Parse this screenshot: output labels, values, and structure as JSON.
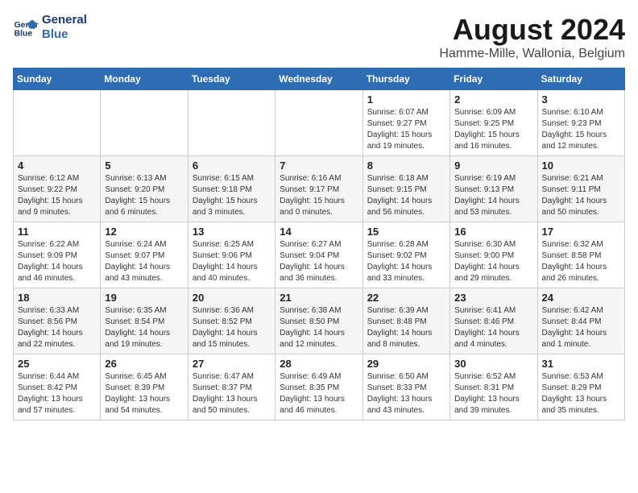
{
  "header": {
    "logo_line1": "General",
    "logo_line2": "Blue",
    "month": "August 2024",
    "location": "Hamme-Mille, Wallonia, Belgium"
  },
  "weekdays": [
    "Sunday",
    "Monday",
    "Tuesday",
    "Wednesday",
    "Thursday",
    "Friday",
    "Saturday"
  ],
  "weeks": [
    [
      {
        "day": "",
        "content": ""
      },
      {
        "day": "",
        "content": ""
      },
      {
        "day": "",
        "content": ""
      },
      {
        "day": "",
        "content": ""
      },
      {
        "day": "1",
        "content": "Sunrise: 6:07 AM\nSunset: 9:27 PM\nDaylight: 15 hours\nand 19 minutes."
      },
      {
        "day": "2",
        "content": "Sunrise: 6:09 AM\nSunset: 9:25 PM\nDaylight: 15 hours\nand 16 minutes."
      },
      {
        "day": "3",
        "content": "Sunrise: 6:10 AM\nSunset: 9:23 PM\nDaylight: 15 hours\nand 12 minutes."
      }
    ],
    [
      {
        "day": "4",
        "content": "Sunrise: 6:12 AM\nSunset: 9:22 PM\nDaylight: 15 hours\nand 9 minutes."
      },
      {
        "day": "5",
        "content": "Sunrise: 6:13 AM\nSunset: 9:20 PM\nDaylight: 15 hours\nand 6 minutes."
      },
      {
        "day": "6",
        "content": "Sunrise: 6:15 AM\nSunset: 9:18 PM\nDaylight: 15 hours\nand 3 minutes."
      },
      {
        "day": "7",
        "content": "Sunrise: 6:16 AM\nSunset: 9:17 PM\nDaylight: 15 hours\nand 0 minutes."
      },
      {
        "day": "8",
        "content": "Sunrise: 6:18 AM\nSunset: 9:15 PM\nDaylight: 14 hours\nand 56 minutes."
      },
      {
        "day": "9",
        "content": "Sunrise: 6:19 AM\nSunset: 9:13 PM\nDaylight: 14 hours\nand 53 minutes."
      },
      {
        "day": "10",
        "content": "Sunrise: 6:21 AM\nSunset: 9:11 PM\nDaylight: 14 hours\nand 50 minutes."
      }
    ],
    [
      {
        "day": "11",
        "content": "Sunrise: 6:22 AM\nSunset: 9:09 PM\nDaylight: 14 hours\nand 46 minutes."
      },
      {
        "day": "12",
        "content": "Sunrise: 6:24 AM\nSunset: 9:07 PM\nDaylight: 14 hours\nand 43 minutes."
      },
      {
        "day": "13",
        "content": "Sunrise: 6:25 AM\nSunset: 9:06 PM\nDaylight: 14 hours\nand 40 minutes."
      },
      {
        "day": "14",
        "content": "Sunrise: 6:27 AM\nSunset: 9:04 PM\nDaylight: 14 hours\nand 36 minutes."
      },
      {
        "day": "15",
        "content": "Sunrise: 6:28 AM\nSunset: 9:02 PM\nDaylight: 14 hours\nand 33 minutes."
      },
      {
        "day": "16",
        "content": "Sunrise: 6:30 AM\nSunset: 9:00 PM\nDaylight: 14 hours\nand 29 minutes."
      },
      {
        "day": "17",
        "content": "Sunrise: 6:32 AM\nSunset: 8:58 PM\nDaylight: 14 hours\nand 26 minutes."
      }
    ],
    [
      {
        "day": "18",
        "content": "Sunrise: 6:33 AM\nSunset: 8:56 PM\nDaylight: 14 hours\nand 22 minutes."
      },
      {
        "day": "19",
        "content": "Sunrise: 6:35 AM\nSunset: 8:54 PM\nDaylight: 14 hours\nand 19 minutes."
      },
      {
        "day": "20",
        "content": "Sunrise: 6:36 AM\nSunset: 8:52 PM\nDaylight: 14 hours\nand 15 minutes."
      },
      {
        "day": "21",
        "content": "Sunrise: 6:38 AM\nSunset: 8:50 PM\nDaylight: 14 hours\nand 12 minutes."
      },
      {
        "day": "22",
        "content": "Sunrise: 6:39 AM\nSunset: 8:48 PM\nDaylight: 14 hours\nand 8 minutes."
      },
      {
        "day": "23",
        "content": "Sunrise: 6:41 AM\nSunset: 8:46 PM\nDaylight: 14 hours\nand 4 minutes."
      },
      {
        "day": "24",
        "content": "Sunrise: 6:42 AM\nSunset: 8:44 PM\nDaylight: 14 hours\nand 1 minute."
      }
    ],
    [
      {
        "day": "25",
        "content": "Sunrise: 6:44 AM\nSunset: 8:42 PM\nDaylight: 13 hours\nand 57 minutes."
      },
      {
        "day": "26",
        "content": "Sunrise: 6:45 AM\nSunset: 8:39 PM\nDaylight: 13 hours\nand 54 minutes."
      },
      {
        "day": "27",
        "content": "Sunrise: 6:47 AM\nSunset: 8:37 PM\nDaylight: 13 hours\nand 50 minutes."
      },
      {
        "day": "28",
        "content": "Sunrise: 6:49 AM\nSunset: 8:35 PM\nDaylight: 13 hours\nand 46 minutes."
      },
      {
        "day": "29",
        "content": "Sunrise: 6:50 AM\nSunset: 8:33 PM\nDaylight: 13 hours\nand 43 minutes."
      },
      {
        "day": "30",
        "content": "Sunrise: 6:52 AM\nSunset: 8:31 PM\nDaylight: 13 hours\nand 39 minutes."
      },
      {
        "day": "31",
        "content": "Sunrise: 6:53 AM\nSunset: 8:29 PM\nDaylight: 13 hours\nand 35 minutes."
      }
    ]
  ]
}
